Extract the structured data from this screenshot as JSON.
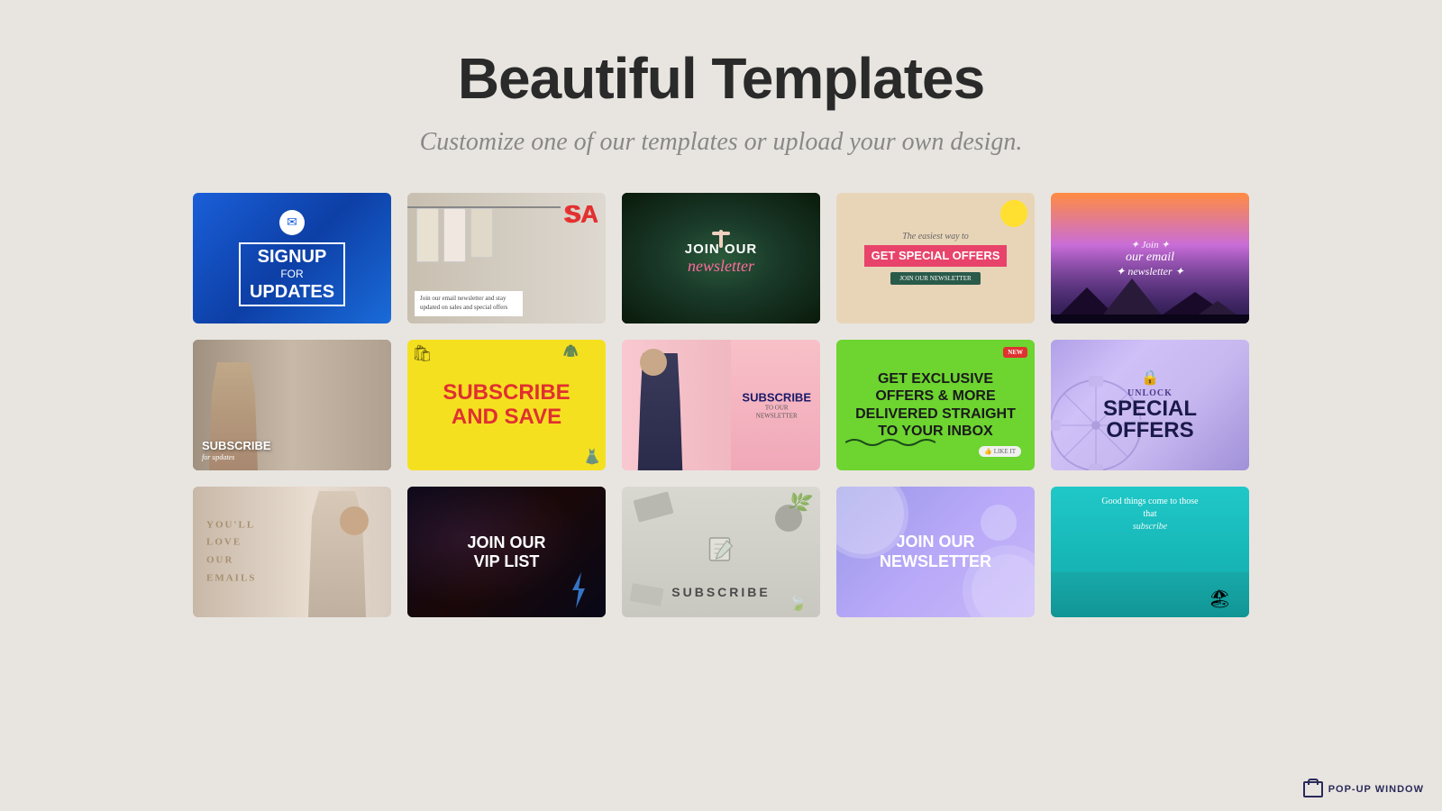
{
  "page": {
    "title": "Beautiful Templates",
    "subtitle": "Customize one of our templates or upload your own design.",
    "background": "#e8e5e0"
  },
  "logo": {
    "text": "POP-UP WINDOW",
    "icon": "popup-icon"
  },
  "templates": [
    {
      "id": 1,
      "label": "Signup for Updates - Blue",
      "text1": "SIGNUP",
      "text2": "FOR",
      "text3": "UPDATES",
      "theme": "blue-marble"
    },
    {
      "id": 2,
      "label": "Sale Newsletter - Clothing Store",
      "text1": "SA",
      "text2": "Join our email newsletter and stay updated on sales and special offers",
      "theme": "clothing-store"
    },
    {
      "id": 3,
      "label": "Join Our Newsletter - Dark",
      "text1": "JOIN OUR",
      "text2": "newsletter",
      "theme": "dark-aerial"
    },
    {
      "id": 4,
      "label": "Get Special Offers - Beige",
      "text1": "The easiest way to",
      "text2": "GET SPECIAL OFFERS",
      "text3": "JOIN OUR NEWSLETTER",
      "theme": "beige"
    },
    {
      "id": 5,
      "label": "Join Email Newsletter - Purple Mountain",
      "text1": "Join",
      "text2": "our email",
      "text3": "newsletter",
      "theme": "purple-mountain"
    },
    {
      "id": 6,
      "label": "Subscribe for Updates - Fashion Photo",
      "text1": "SUBSCRIBE",
      "text2": "for updates",
      "theme": "fashion-photo"
    },
    {
      "id": 7,
      "label": "Subscribe and Save - Yellow",
      "text1": "SUBSCRIBE",
      "text2": "AND SAVE",
      "theme": "yellow-illustration"
    },
    {
      "id": 8,
      "label": "Subscribe to Newsletter - Pink Photo",
      "text1": "SUBSCRIBE",
      "text2": "TO OUR NEWSLETTER",
      "theme": "pink-photo"
    },
    {
      "id": 9,
      "label": "Get Exclusive Offers - Green",
      "text1": "GET EXCLUSIVE",
      "text2": "OFFERS & MORE",
      "text3": "DELIVERED STRAIGHT",
      "text4": "TO YOUR INBOX",
      "badge": "NEW",
      "like": "LIKE IT",
      "theme": "green"
    },
    {
      "id": 10,
      "label": "Unlock Special Offers - Purple",
      "text1": "UNLOCK",
      "text2": "SPECIAL",
      "text3": "OFFERS",
      "theme": "purple-gradient"
    },
    {
      "id": 11,
      "label": "You'll Love Our Emails - Fashion",
      "text1": "YOU'LL",
      "text2": "LOVE",
      "text3": "OUR",
      "text4": "EMAILS",
      "theme": "fashion-minimal"
    },
    {
      "id": 12,
      "label": "Join Our VIP List - Dark",
      "text1": "JOIN OUR",
      "text2": "VIP LIST",
      "theme": "dark-dramatic"
    },
    {
      "id": 13,
      "label": "Subscribe - Minimal Flat",
      "text1": "SUBSCRIBE",
      "theme": "minimal-flat"
    },
    {
      "id": 14,
      "label": "Join Our Newsletter - Purple Bubble",
      "text1": "JOIN OUR",
      "text2": "NEWSLETTER",
      "theme": "purple-bubble"
    },
    {
      "id": 15,
      "label": "Good Things Come - Teal Beach",
      "text1": "Good things come to those that",
      "text2": "subscribe",
      "theme": "teal-beach"
    }
  ]
}
